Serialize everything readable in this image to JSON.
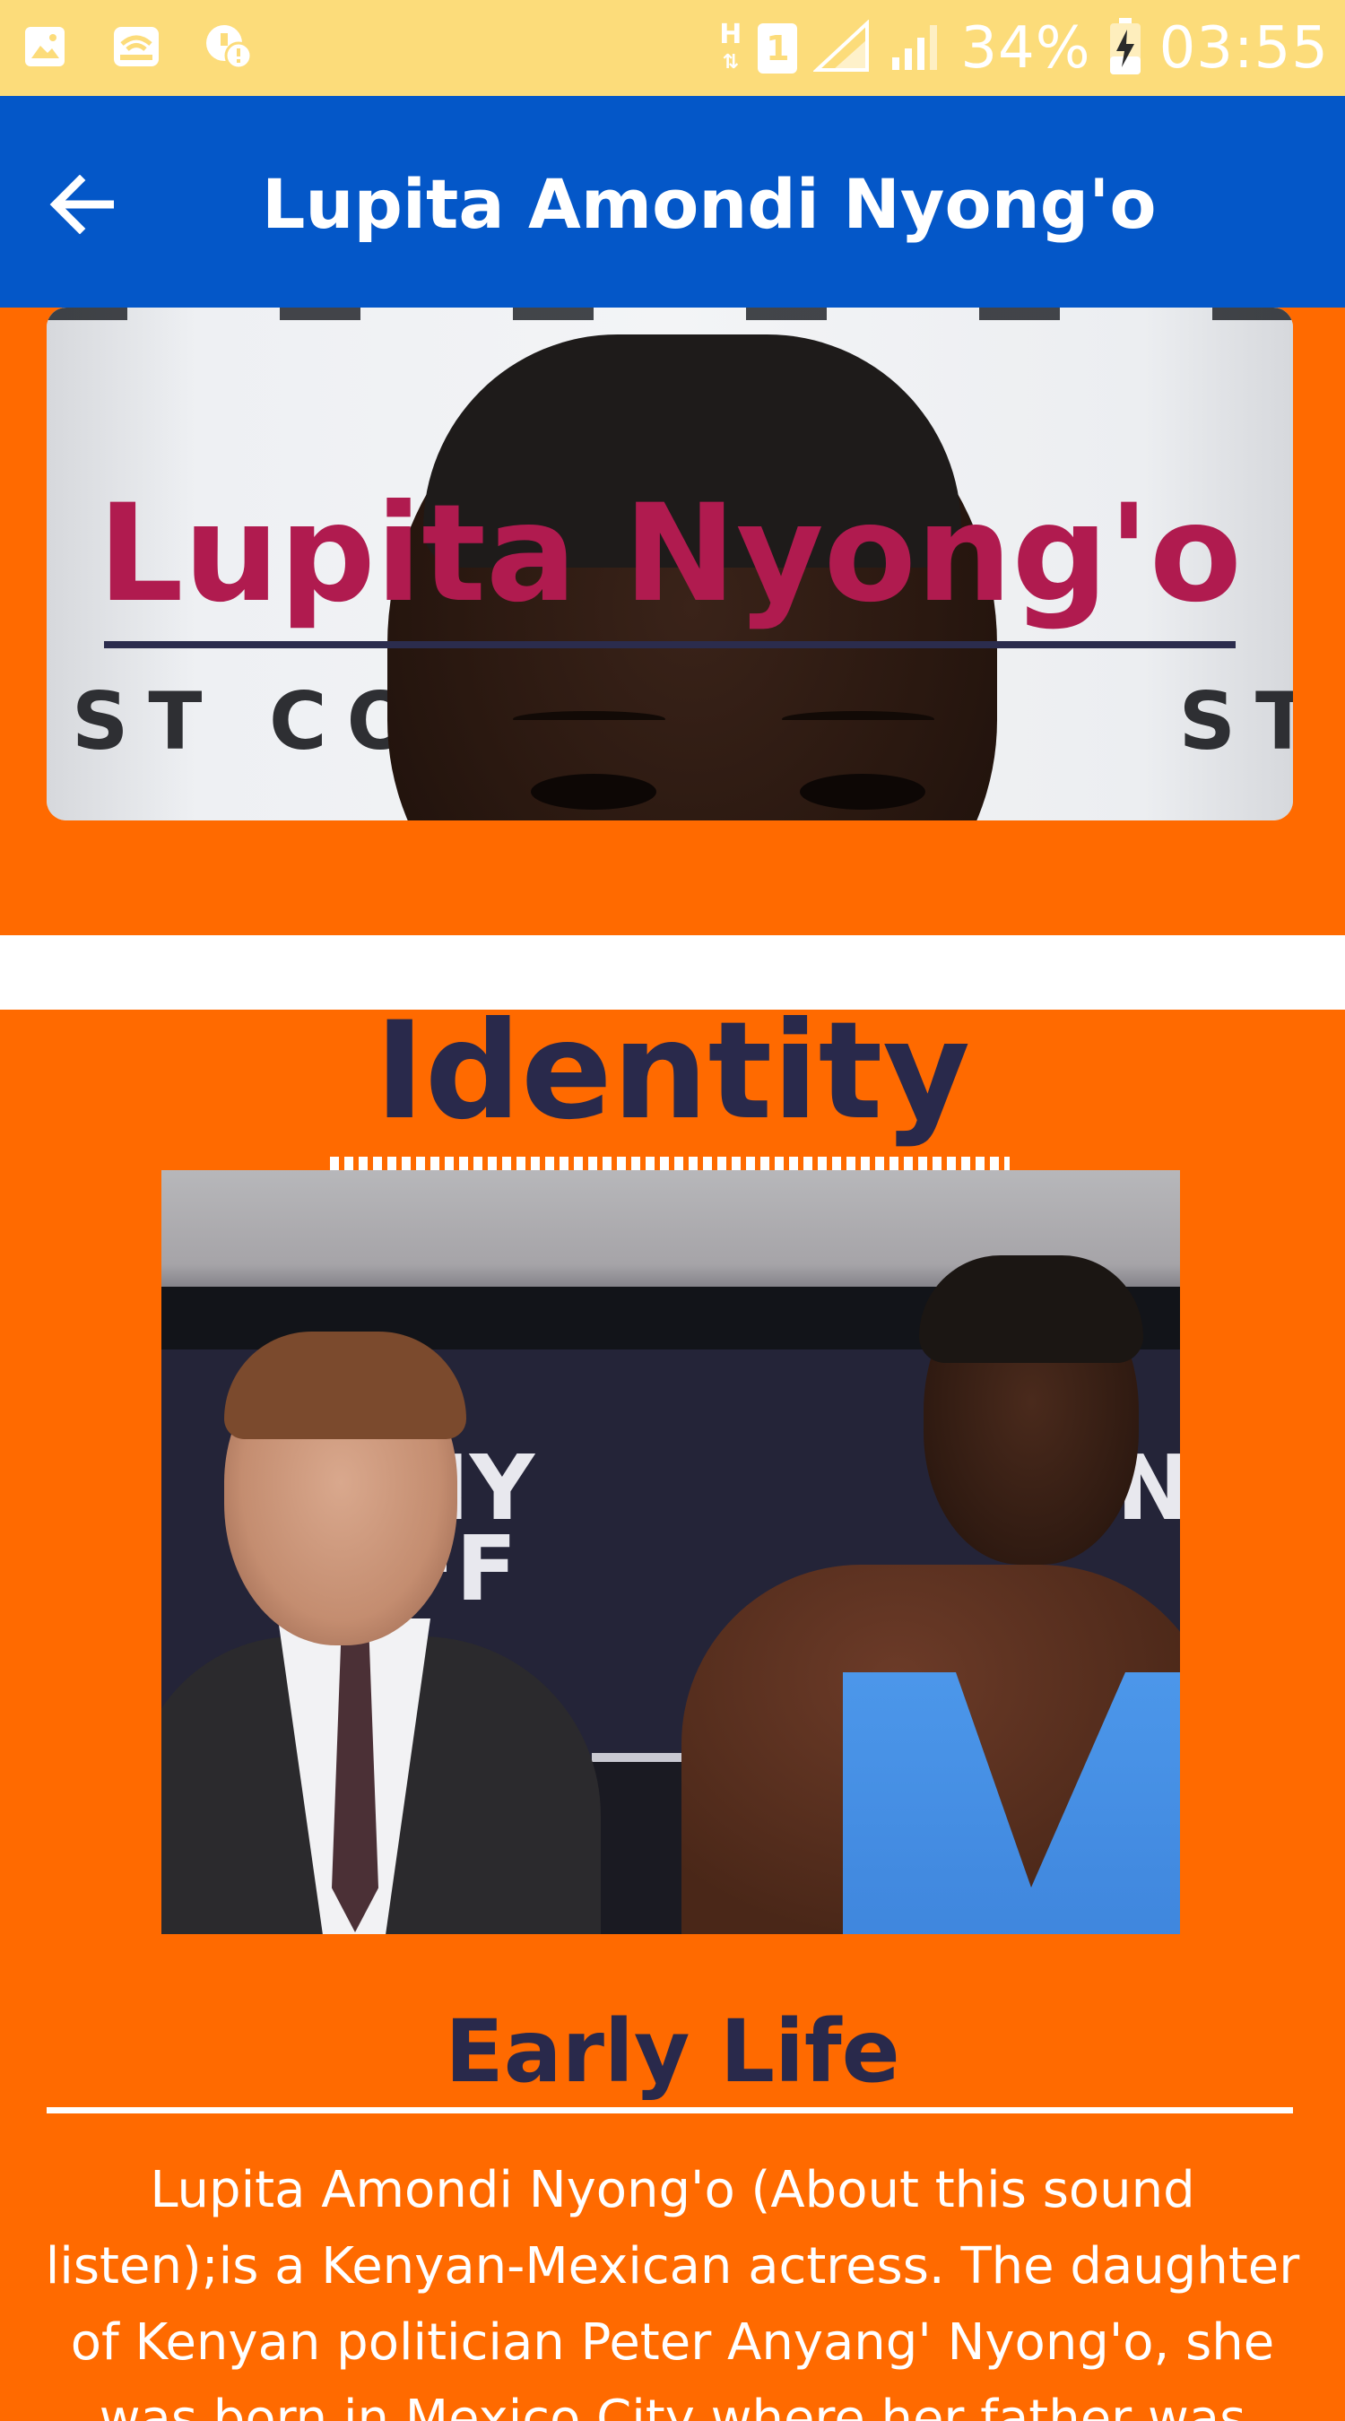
{
  "status_bar": {
    "icons_left": [
      "image-icon",
      "wifi-router-icon",
      "cloud-warning-icon"
    ],
    "network_label": "H",
    "sim_label": "1",
    "battery": "34%",
    "time": "03:55"
  },
  "app_bar": {
    "title": "Lupita Amondi Nyong'o",
    "back_icon": "arrow-back-icon"
  },
  "hero": {
    "name": "Lupita Nyong'o",
    "background_text_left": "ST CO",
    "background_text_right": "ST"
  },
  "sections": {
    "identity": {
      "heading": "Identity",
      "photo_logo_left": "NY\nFF",
      "photo_logo_right": "N"
    },
    "early_life": {
      "heading": "Early Life",
      "body": "Lupita Amondi Nyong'o (About this sound listen);is a Kenyan-Mexican actress. The daughter of Kenyan politician Peter Anyang' Nyong'o, she was born in Mexico City where her father was teaching and was"
    }
  },
  "colors": {
    "status_bar_bg": "#fcdc7a",
    "app_bar_bg": "#0457c8",
    "page_bg": "#ff6a00",
    "heading_color": "#29294b",
    "hero_name_color": "#b01b4f"
  }
}
